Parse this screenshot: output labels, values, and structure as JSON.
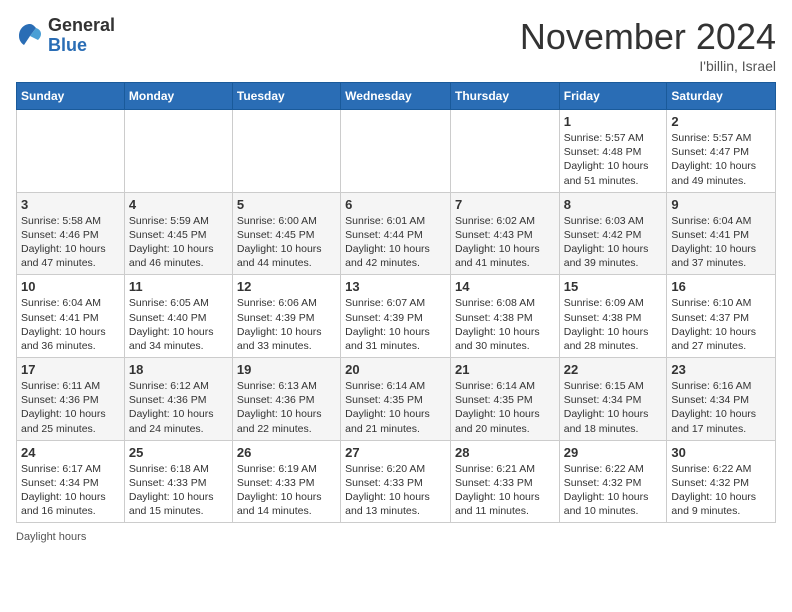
{
  "logo": {
    "general": "General",
    "blue": "Blue"
  },
  "title": "November 2024",
  "location": "I'billin, Israel",
  "days_header": [
    "Sunday",
    "Monday",
    "Tuesday",
    "Wednesday",
    "Thursday",
    "Friday",
    "Saturday"
  ],
  "weeks": [
    [
      {
        "day": "",
        "sunrise": "",
        "sunset": "",
        "daylight": ""
      },
      {
        "day": "",
        "sunrise": "",
        "sunset": "",
        "daylight": ""
      },
      {
        "day": "",
        "sunrise": "",
        "sunset": "",
        "daylight": ""
      },
      {
        "day": "",
        "sunrise": "",
        "sunset": "",
        "daylight": ""
      },
      {
        "day": "",
        "sunrise": "",
        "sunset": "",
        "daylight": ""
      },
      {
        "day": "1",
        "sunrise": "Sunrise: 5:57 AM",
        "sunset": "Sunset: 4:48 PM",
        "daylight": "Daylight: 10 hours and 51 minutes."
      },
      {
        "day": "2",
        "sunrise": "Sunrise: 5:57 AM",
        "sunset": "Sunset: 4:47 PM",
        "daylight": "Daylight: 10 hours and 49 minutes."
      }
    ],
    [
      {
        "day": "3",
        "sunrise": "Sunrise: 5:58 AM",
        "sunset": "Sunset: 4:46 PM",
        "daylight": "Daylight: 10 hours and 47 minutes."
      },
      {
        "day": "4",
        "sunrise": "Sunrise: 5:59 AM",
        "sunset": "Sunset: 4:45 PM",
        "daylight": "Daylight: 10 hours and 46 minutes."
      },
      {
        "day": "5",
        "sunrise": "Sunrise: 6:00 AM",
        "sunset": "Sunset: 4:45 PM",
        "daylight": "Daylight: 10 hours and 44 minutes."
      },
      {
        "day": "6",
        "sunrise": "Sunrise: 6:01 AM",
        "sunset": "Sunset: 4:44 PM",
        "daylight": "Daylight: 10 hours and 42 minutes."
      },
      {
        "day": "7",
        "sunrise": "Sunrise: 6:02 AM",
        "sunset": "Sunset: 4:43 PM",
        "daylight": "Daylight: 10 hours and 41 minutes."
      },
      {
        "day": "8",
        "sunrise": "Sunrise: 6:03 AM",
        "sunset": "Sunset: 4:42 PM",
        "daylight": "Daylight: 10 hours and 39 minutes."
      },
      {
        "day": "9",
        "sunrise": "Sunrise: 6:04 AM",
        "sunset": "Sunset: 4:41 PM",
        "daylight": "Daylight: 10 hours and 37 minutes."
      }
    ],
    [
      {
        "day": "10",
        "sunrise": "Sunrise: 6:04 AM",
        "sunset": "Sunset: 4:41 PM",
        "daylight": "Daylight: 10 hours and 36 minutes."
      },
      {
        "day": "11",
        "sunrise": "Sunrise: 6:05 AM",
        "sunset": "Sunset: 4:40 PM",
        "daylight": "Daylight: 10 hours and 34 minutes."
      },
      {
        "day": "12",
        "sunrise": "Sunrise: 6:06 AM",
        "sunset": "Sunset: 4:39 PM",
        "daylight": "Daylight: 10 hours and 33 minutes."
      },
      {
        "day": "13",
        "sunrise": "Sunrise: 6:07 AM",
        "sunset": "Sunset: 4:39 PM",
        "daylight": "Daylight: 10 hours and 31 minutes."
      },
      {
        "day": "14",
        "sunrise": "Sunrise: 6:08 AM",
        "sunset": "Sunset: 4:38 PM",
        "daylight": "Daylight: 10 hours and 30 minutes."
      },
      {
        "day": "15",
        "sunrise": "Sunrise: 6:09 AM",
        "sunset": "Sunset: 4:38 PM",
        "daylight": "Daylight: 10 hours and 28 minutes."
      },
      {
        "day": "16",
        "sunrise": "Sunrise: 6:10 AM",
        "sunset": "Sunset: 4:37 PM",
        "daylight": "Daylight: 10 hours and 27 minutes."
      }
    ],
    [
      {
        "day": "17",
        "sunrise": "Sunrise: 6:11 AM",
        "sunset": "Sunset: 4:36 PM",
        "daylight": "Daylight: 10 hours and 25 minutes."
      },
      {
        "day": "18",
        "sunrise": "Sunrise: 6:12 AM",
        "sunset": "Sunset: 4:36 PM",
        "daylight": "Daylight: 10 hours and 24 minutes."
      },
      {
        "day": "19",
        "sunrise": "Sunrise: 6:13 AM",
        "sunset": "Sunset: 4:36 PM",
        "daylight": "Daylight: 10 hours and 22 minutes."
      },
      {
        "day": "20",
        "sunrise": "Sunrise: 6:14 AM",
        "sunset": "Sunset: 4:35 PM",
        "daylight": "Daylight: 10 hours and 21 minutes."
      },
      {
        "day": "21",
        "sunrise": "Sunrise: 6:14 AM",
        "sunset": "Sunset: 4:35 PM",
        "daylight": "Daylight: 10 hours and 20 minutes."
      },
      {
        "day": "22",
        "sunrise": "Sunrise: 6:15 AM",
        "sunset": "Sunset: 4:34 PM",
        "daylight": "Daylight: 10 hours and 18 minutes."
      },
      {
        "day": "23",
        "sunrise": "Sunrise: 6:16 AM",
        "sunset": "Sunset: 4:34 PM",
        "daylight": "Daylight: 10 hours and 17 minutes."
      }
    ],
    [
      {
        "day": "24",
        "sunrise": "Sunrise: 6:17 AM",
        "sunset": "Sunset: 4:34 PM",
        "daylight": "Daylight: 10 hours and 16 minutes."
      },
      {
        "day": "25",
        "sunrise": "Sunrise: 6:18 AM",
        "sunset": "Sunset: 4:33 PM",
        "daylight": "Daylight: 10 hours and 15 minutes."
      },
      {
        "day": "26",
        "sunrise": "Sunrise: 6:19 AM",
        "sunset": "Sunset: 4:33 PM",
        "daylight": "Daylight: 10 hours and 14 minutes."
      },
      {
        "day": "27",
        "sunrise": "Sunrise: 6:20 AM",
        "sunset": "Sunset: 4:33 PM",
        "daylight": "Daylight: 10 hours and 13 minutes."
      },
      {
        "day": "28",
        "sunrise": "Sunrise: 6:21 AM",
        "sunset": "Sunset: 4:33 PM",
        "daylight": "Daylight: 10 hours and 11 minutes."
      },
      {
        "day": "29",
        "sunrise": "Sunrise: 6:22 AM",
        "sunset": "Sunset: 4:32 PM",
        "daylight": "Daylight: 10 hours and 10 minutes."
      },
      {
        "day": "30",
        "sunrise": "Sunrise: 6:22 AM",
        "sunset": "Sunset: 4:32 PM",
        "daylight": "Daylight: 10 hours and 9 minutes."
      }
    ]
  ],
  "footer": "Daylight hours"
}
